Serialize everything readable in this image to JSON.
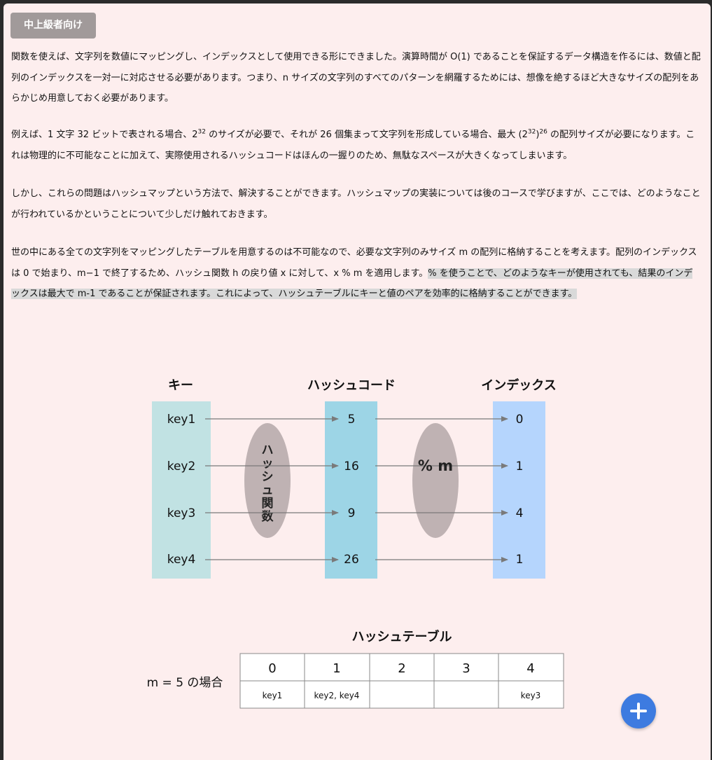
{
  "badge": "中上級者向け",
  "paragraphs": {
    "p1": "関数を使えば、文字列を数値にマッピングし、インデックスとして使用できる形にできました。演算時間が O(1) であることを保証するデータ構造を作るには、数値と配列のインデックスを一対一に対応させる必要があります。つまり、n サイズの文字列のすべてのパターンを網羅するためには、想像を絶するほど大きなサイズの配列をあらかじめ用意しておく必要があります。",
    "p2_a": "例えば、1 文字 32 ビットで表される場合、2",
    "p2_sup1": "32",
    "p2_b": " のサイズが必要で、それが 26 個集まって文字列を形成している場合、最大 (2",
    "p2_sup2": "32",
    "p2_c": ")",
    "p2_sup3": "26",
    "p2_d": " の配列サイズが必要になります。これは物理的に不可能なことに加えて、実際使用されるハッシュコードはほんの一握りのため、無駄なスペースが大きくなってしまいます。",
    "p3": "しかし、これらの問題はハッシュマップという方法で、解決することができます。ハッシュマップの実装については後のコースで学びますが、ここでは、どのようなことが行われているかということについて少しだけ触れておきます。",
    "p4_a": "世の中にある全ての文字列をマッピングしたテーブルを用意するのは不可能なので、必要な文字列のみサイズ m の配列に格納することを考えます。配列のインデックスは 0 で始まり、m−1 で終了するため、ハッシュ関数 h の戻り値 x に対して、x % m を適用します。",
    "p4_b": "% を使うことで、どのようなキーが使用されても、結果のインデックスは最大で m-1 であることが保証されます。これによって、ハッシュテーブルにキーと値のペアを効率的に格納することができます。"
  },
  "diagram": {
    "headers": {
      "keys": "キー",
      "hash_codes": "ハッシュコード",
      "indexes": "インデックス"
    },
    "keys": [
      "key1",
      "key2",
      "key3",
      "key4"
    ],
    "hash_codes": [
      "5",
      "16",
      "9",
      "26"
    ],
    "indexes": [
      "0",
      "1",
      "4",
      "1"
    ],
    "hash_function_chars": [
      "ハ",
      "ッ",
      "シ",
      "ュ",
      "関",
      "数"
    ],
    "modulo_label": "% m",
    "colors": {
      "keys_col": "#c1e2e3",
      "hash_col": "#9dd5e6",
      "index_col": "#b5d5fd",
      "ellipse": "#bfb2b3",
      "arrow": "#7a7a7a"
    }
  },
  "table": {
    "title": "ハッシュテーブル",
    "label": "m = 5 の場合",
    "indices": [
      "0",
      "1",
      "2",
      "3",
      "4"
    ],
    "values": [
      "key1",
      "key2, key4",
      "",
      "",
      "key3"
    ]
  },
  "fab": {
    "icon": "plus-icon",
    "color": "#3d7be0"
  }
}
